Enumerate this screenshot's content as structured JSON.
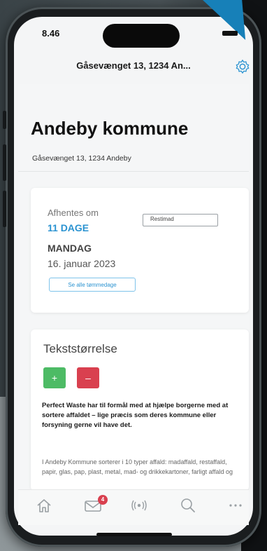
{
  "status_bar": {
    "time": "8.46"
  },
  "nav": {
    "title": "Gåsevænget 13, 1234 An...",
    "settings_icon": "gear-icon"
  },
  "header": {
    "municipality": "Andeby kommune",
    "address": "Gåsevænget 13, 1234 Andeby"
  },
  "pickup": {
    "label": "Afhentes om",
    "days": "11 DAGE",
    "waste_type": "Restimad",
    "weekday": "MANDAG",
    "date": "16. januar 2023",
    "all_dates_button": "Se alle tømmedage"
  },
  "text_size": {
    "title": "Tekststørrelse",
    "increase": "+",
    "decrease": "–"
  },
  "description": {
    "intro": "Perfect Waste har til formål med at hjælpe borgerne med at sortere affaldet – lige præcis som deres kommune eller forsyning gerne vil have det.",
    "body": "I Andeby Kommune sorterer i 10 typer affald: madaffald, restaffald, papir, glas, pap, plast, metal, mad- og drikkekartoner, farligt affald og"
  },
  "tabbar": {
    "items": [
      "home-icon",
      "mail-icon",
      "sensor-icon",
      "search-icon",
      "more-icon"
    ],
    "mail_badge": "4"
  },
  "colors": {
    "accent": "#2b93d1",
    "pointer": "#1780b8",
    "increase": "#4dbb65",
    "decrease": "#d9404f"
  }
}
